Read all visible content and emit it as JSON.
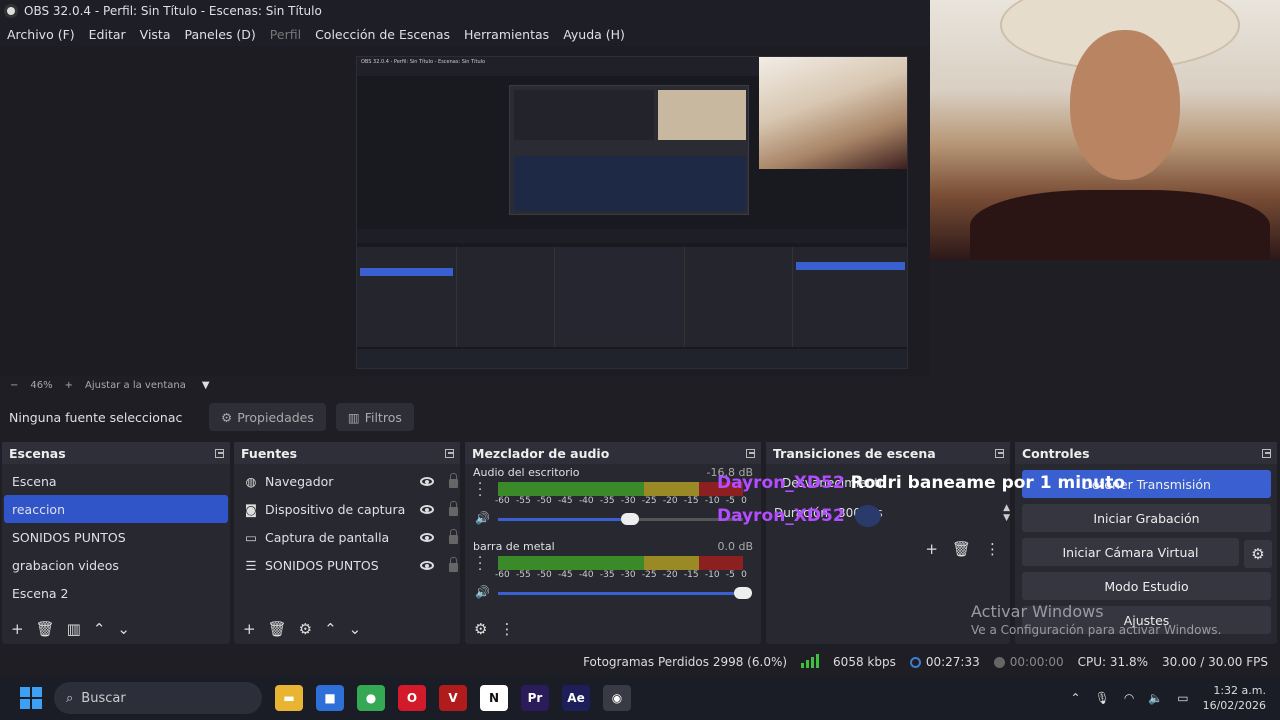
{
  "window": {
    "title": "OBS 32.0.4 - Perfil: Sin Título - Escenas: Sin Título"
  },
  "menu": [
    {
      "label": "Archivo (F)",
      "disabled": false
    },
    {
      "label": "Editar",
      "disabled": false
    },
    {
      "label": "Vista",
      "disabled": false
    },
    {
      "label": "Paneles (D)",
      "disabled": false
    },
    {
      "label": "Perfil",
      "disabled": true
    },
    {
      "label": "Colección de Escenas",
      "disabled": false
    },
    {
      "label": "Herramientas",
      "disabled": false
    },
    {
      "label": "Ayuda (H)",
      "disabled": false
    }
  ],
  "preview_toolbar": {
    "zoom_minus": "−",
    "zoom": "46%",
    "zoom_plus": "+",
    "fit": "Ajustar a la ventana"
  },
  "source_toolbar": {
    "selection": "Ninguna fuente seleccionac",
    "properties": "Propiedades",
    "filters": "Filtros"
  },
  "scenes": {
    "title": "Escenas",
    "items": [
      {
        "label": "Escena",
        "active": false
      },
      {
        "label": "reaccion",
        "active": true
      },
      {
        "label": "SONIDOS PUNTOS",
        "active": false
      },
      {
        "label": "grabacion videos",
        "active": false
      },
      {
        "label": "Escena 2",
        "active": false
      }
    ]
  },
  "sources": {
    "title": "Fuentes",
    "items": [
      {
        "label": "Navegador",
        "icon": "globe-icon"
      },
      {
        "label": "Dispositivo de captura de",
        "icon": "camera-icon"
      },
      {
        "label": "Captura de pantalla",
        "icon": "monitor-icon"
      },
      {
        "label": "SONIDOS PUNTOS",
        "icon": "list-icon"
      }
    ]
  },
  "mixer": {
    "title": "Mezclador de audio",
    "scale": [
      "-60",
      "-55",
      "-50",
      "-45",
      "-40",
      "-35",
      "-30",
      "-25",
      "-20",
      "-15",
      "-10",
      "-5",
      "0"
    ],
    "channels": [
      {
        "name": "Audio del escritorio",
        "db": "-16.8 dB",
        "volume": 0.54
      },
      {
        "name": "barra de metal",
        "db": "0.0 dB",
        "volume": 1.0
      }
    ]
  },
  "transitions": {
    "title": "Transiciones de escena",
    "fade_label": "Desvanecimiento",
    "duration_label": "Duración",
    "duration_value": "300 ms"
  },
  "controls": {
    "title": "Controles",
    "buttons": [
      "Detener Transmisión",
      "Iniciar Grabación",
      "Iniciar Cámara Virtual",
      "Modo Estudio",
      "Ajustes"
    ]
  },
  "chat_overlay": {
    "line1_user": "Dayron_XD52",
    "line1_msg": "Rodri baneame por 1 minuto",
    "line2_user": "Dayron_XD52"
  },
  "activation": {
    "line1": "Activar Windows",
    "line2": "Ve a Configuración para activar Windows."
  },
  "status": {
    "dropped_frames": "Fotogramas Perdidos 2998 (6.0%)",
    "bitrate": "6058 kbps",
    "stream_time": "00:27:33",
    "rec_time": "00:00:00",
    "cpu": "CPU: 31.8%",
    "fps": "30.00 / 30.00 FPS"
  },
  "taskbar": {
    "search_placeholder": "Buscar",
    "apps": [
      {
        "name": "file-explorer-icon",
        "color": "#e8b432",
        "glyph": "▬"
      },
      {
        "name": "microsoft-store-icon",
        "color": "#2e6fd8",
        "glyph": "■"
      },
      {
        "name": "chrome-icon",
        "color": "#34a853",
        "glyph": "●"
      },
      {
        "name": "opera-icon",
        "color": "#d21a2a",
        "glyph": "O"
      },
      {
        "name": "voicemeeter-icon",
        "color": "#b01c1c",
        "glyph": "V"
      },
      {
        "name": "notion-icon",
        "color": "#ffffff",
        "glyph": "N"
      },
      {
        "name": "premiere-icon",
        "color": "#2a1c5a",
        "glyph": "Pr"
      },
      {
        "name": "after-effects-icon",
        "color": "#1c1f5a",
        "glyph": "Ae"
      },
      {
        "name": "obs-icon",
        "color": "#3a3a44",
        "glyph": "◉"
      }
    ],
    "time": "1:32 a.m.",
    "date": "16/02/2026"
  }
}
